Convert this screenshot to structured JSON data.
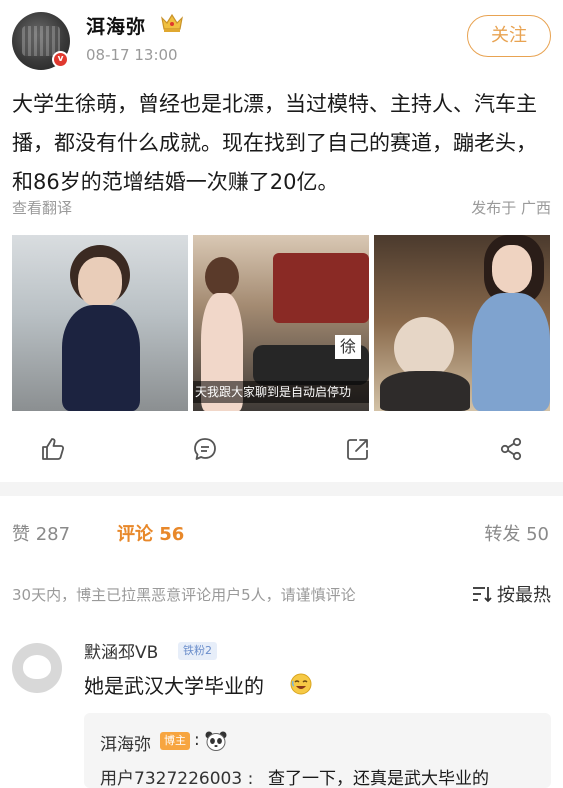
{
  "post": {
    "author": "洱海弥",
    "time": "08-17 13:00",
    "follow_label": "关注",
    "text": "大学生徐萌，曾经也是北漂，当过模特、主持人、汽车主播，都没有什么成就。现在找到了自己的赛道，蹦老头，和86岁的范增结婚一次赚了20亿。",
    "translate_label": "查看翻译",
    "location": "发布于 广西",
    "photo_caption": "天我跟大家聊到是自动启停功",
    "photo_overlay_char": "徐"
  },
  "stats": {
    "likes": "赞 287",
    "comments": "评论 56",
    "reposts": "转发 50"
  },
  "comment_notice": "30天内，博主已拉黑恶意评论用户5人，请谨慎评论",
  "sort_label": "按最热",
  "comment": {
    "user": "默涵邳VB",
    "badge": "铁粉2",
    "text": "她是武汉大学毕业的",
    "reply": {
      "author": "洱海弥",
      "author_badge": "博主",
      "colon": ":",
      "user2": "用户7327226003 :",
      "text2": "查了一下，还真是武大毕业的"
    }
  },
  "icons": {
    "crown": "crown-icon",
    "like": "thumbs-up-icon",
    "comment": "comment-icon",
    "repost": "share-arrow-icon",
    "share": "share-nodes-icon",
    "sort": "sort-icon",
    "laugh": "laugh-emoji-icon",
    "face": "panda-face-icon"
  },
  "colors": {
    "accent": "#e8882a",
    "follow": "#e8a352",
    "verified": "#e0392f"
  }
}
